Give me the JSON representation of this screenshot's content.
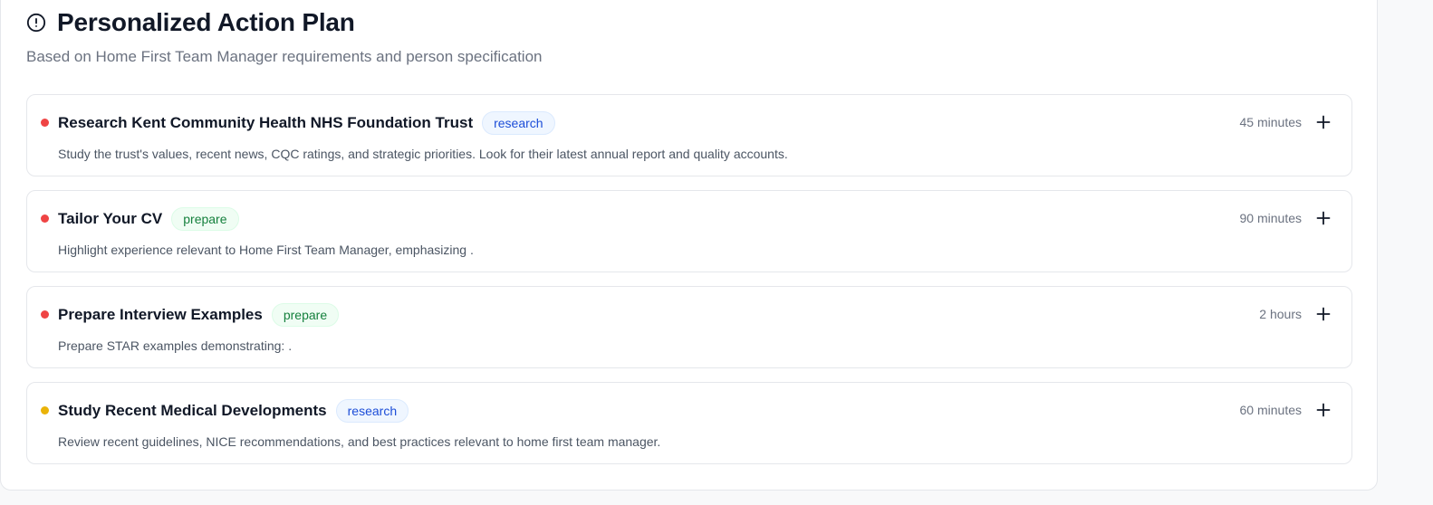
{
  "header": {
    "icon": "alert-circle-icon",
    "title": "Personalized Action Plan",
    "subtitle": "Based on Home First Team Manager requirements and person specification"
  },
  "colors": {
    "priority_high": "#ef4444",
    "priority_medium": "#eab308",
    "research_badge": "#1d4ed8",
    "prepare_badge": "#15803d"
  },
  "items": [
    {
      "title": "Research Kent Community Health NHS Foundation Trust",
      "badge": "research",
      "duration": "45 minutes",
      "description": "Study the trust's values, recent news, CQC ratings, and strategic priorities. Look for their latest annual report and quality accounts.",
      "priority": "high",
      "icon": "plus-icon"
    },
    {
      "title": "Tailor Your CV",
      "badge": "prepare",
      "duration": "90 minutes",
      "description": "Highlight experience relevant to Home First Team Manager, emphasizing .",
      "priority": "high",
      "icon": "plus-icon"
    },
    {
      "title": "Prepare Interview Examples",
      "badge": "prepare",
      "duration": "2 hours",
      "description": "Prepare STAR examples demonstrating: .",
      "priority": "high",
      "icon": "plus-icon"
    },
    {
      "title": "Study Recent Medical Developments",
      "badge": "research",
      "duration": "60 minutes",
      "description": "Review recent guidelines, NICE recommendations, and best practices relevant to home first team manager.",
      "priority": "medium",
      "icon": "plus-icon"
    }
  ]
}
